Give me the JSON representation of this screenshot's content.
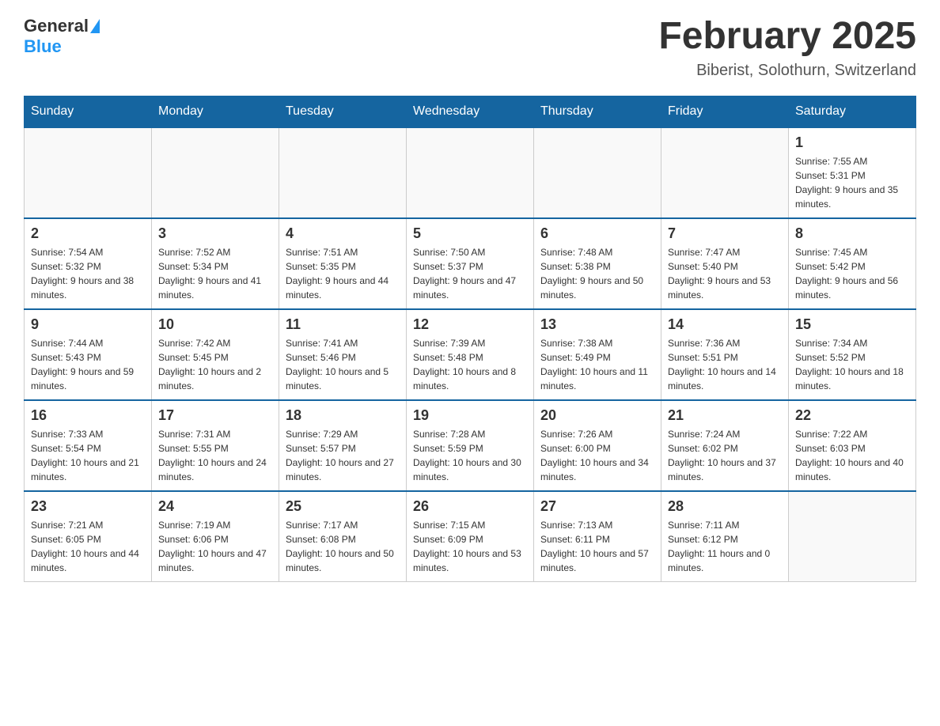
{
  "header": {
    "logo_general": "General",
    "logo_blue": "Blue",
    "main_title": "February 2025",
    "subtitle": "Biberist, Solothurn, Switzerland"
  },
  "weekdays": [
    "Sunday",
    "Monday",
    "Tuesday",
    "Wednesday",
    "Thursday",
    "Friday",
    "Saturday"
  ],
  "weeks": [
    [
      {
        "day": "",
        "sunrise": "",
        "sunset": "",
        "daylight": ""
      },
      {
        "day": "",
        "sunrise": "",
        "sunset": "",
        "daylight": ""
      },
      {
        "day": "",
        "sunrise": "",
        "sunset": "",
        "daylight": ""
      },
      {
        "day": "",
        "sunrise": "",
        "sunset": "",
        "daylight": ""
      },
      {
        "day": "",
        "sunrise": "",
        "sunset": "",
        "daylight": ""
      },
      {
        "day": "",
        "sunrise": "",
        "sunset": "",
        "daylight": ""
      },
      {
        "day": "1",
        "sunrise": "Sunrise: 7:55 AM",
        "sunset": "Sunset: 5:31 PM",
        "daylight": "Daylight: 9 hours and 35 minutes."
      }
    ],
    [
      {
        "day": "2",
        "sunrise": "Sunrise: 7:54 AM",
        "sunset": "Sunset: 5:32 PM",
        "daylight": "Daylight: 9 hours and 38 minutes."
      },
      {
        "day": "3",
        "sunrise": "Sunrise: 7:52 AM",
        "sunset": "Sunset: 5:34 PM",
        "daylight": "Daylight: 9 hours and 41 minutes."
      },
      {
        "day": "4",
        "sunrise": "Sunrise: 7:51 AM",
        "sunset": "Sunset: 5:35 PM",
        "daylight": "Daylight: 9 hours and 44 minutes."
      },
      {
        "day": "5",
        "sunrise": "Sunrise: 7:50 AM",
        "sunset": "Sunset: 5:37 PM",
        "daylight": "Daylight: 9 hours and 47 minutes."
      },
      {
        "day": "6",
        "sunrise": "Sunrise: 7:48 AM",
        "sunset": "Sunset: 5:38 PM",
        "daylight": "Daylight: 9 hours and 50 minutes."
      },
      {
        "day": "7",
        "sunrise": "Sunrise: 7:47 AM",
        "sunset": "Sunset: 5:40 PM",
        "daylight": "Daylight: 9 hours and 53 minutes."
      },
      {
        "day": "8",
        "sunrise": "Sunrise: 7:45 AM",
        "sunset": "Sunset: 5:42 PM",
        "daylight": "Daylight: 9 hours and 56 minutes."
      }
    ],
    [
      {
        "day": "9",
        "sunrise": "Sunrise: 7:44 AM",
        "sunset": "Sunset: 5:43 PM",
        "daylight": "Daylight: 9 hours and 59 minutes."
      },
      {
        "day": "10",
        "sunrise": "Sunrise: 7:42 AM",
        "sunset": "Sunset: 5:45 PM",
        "daylight": "Daylight: 10 hours and 2 minutes."
      },
      {
        "day": "11",
        "sunrise": "Sunrise: 7:41 AM",
        "sunset": "Sunset: 5:46 PM",
        "daylight": "Daylight: 10 hours and 5 minutes."
      },
      {
        "day": "12",
        "sunrise": "Sunrise: 7:39 AM",
        "sunset": "Sunset: 5:48 PM",
        "daylight": "Daylight: 10 hours and 8 minutes."
      },
      {
        "day": "13",
        "sunrise": "Sunrise: 7:38 AM",
        "sunset": "Sunset: 5:49 PM",
        "daylight": "Daylight: 10 hours and 11 minutes."
      },
      {
        "day": "14",
        "sunrise": "Sunrise: 7:36 AM",
        "sunset": "Sunset: 5:51 PM",
        "daylight": "Daylight: 10 hours and 14 minutes."
      },
      {
        "day": "15",
        "sunrise": "Sunrise: 7:34 AM",
        "sunset": "Sunset: 5:52 PM",
        "daylight": "Daylight: 10 hours and 18 minutes."
      }
    ],
    [
      {
        "day": "16",
        "sunrise": "Sunrise: 7:33 AM",
        "sunset": "Sunset: 5:54 PM",
        "daylight": "Daylight: 10 hours and 21 minutes."
      },
      {
        "day": "17",
        "sunrise": "Sunrise: 7:31 AM",
        "sunset": "Sunset: 5:55 PM",
        "daylight": "Daylight: 10 hours and 24 minutes."
      },
      {
        "day": "18",
        "sunrise": "Sunrise: 7:29 AM",
        "sunset": "Sunset: 5:57 PM",
        "daylight": "Daylight: 10 hours and 27 minutes."
      },
      {
        "day": "19",
        "sunrise": "Sunrise: 7:28 AM",
        "sunset": "Sunset: 5:59 PM",
        "daylight": "Daylight: 10 hours and 30 minutes."
      },
      {
        "day": "20",
        "sunrise": "Sunrise: 7:26 AM",
        "sunset": "Sunset: 6:00 PM",
        "daylight": "Daylight: 10 hours and 34 minutes."
      },
      {
        "day": "21",
        "sunrise": "Sunrise: 7:24 AM",
        "sunset": "Sunset: 6:02 PM",
        "daylight": "Daylight: 10 hours and 37 minutes."
      },
      {
        "day": "22",
        "sunrise": "Sunrise: 7:22 AM",
        "sunset": "Sunset: 6:03 PM",
        "daylight": "Daylight: 10 hours and 40 minutes."
      }
    ],
    [
      {
        "day": "23",
        "sunrise": "Sunrise: 7:21 AM",
        "sunset": "Sunset: 6:05 PM",
        "daylight": "Daylight: 10 hours and 44 minutes."
      },
      {
        "day": "24",
        "sunrise": "Sunrise: 7:19 AM",
        "sunset": "Sunset: 6:06 PM",
        "daylight": "Daylight: 10 hours and 47 minutes."
      },
      {
        "day": "25",
        "sunrise": "Sunrise: 7:17 AM",
        "sunset": "Sunset: 6:08 PM",
        "daylight": "Daylight: 10 hours and 50 minutes."
      },
      {
        "day": "26",
        "sunrise": "Sunrise: 7:15 AM",
        "sunset": "Sunset: 6:09 PM",
        "daylight": "Daylight: 10 hours and 53 minutes."
      },
      {
        "day": "27",
        "sunrise": "Sunrise: 7:13 AM",
        "sunset": "Sunset: 6:11 PM",
        "daylight": "Daylight: 10 hours and 57 minutes."
      },
      {
        "day": "28",
        "sunrise": "Sunrise: 7:11 AM",
        "sunset": "Sunset: 6:12 PM",
        "daylight": "Daylight: 11 hours and 0 minutes."
      },
      {
        "day": "",
        "sunrise": "",
        "sunset": "",
        "daylight": ""
      }
    ]
  ]
}
